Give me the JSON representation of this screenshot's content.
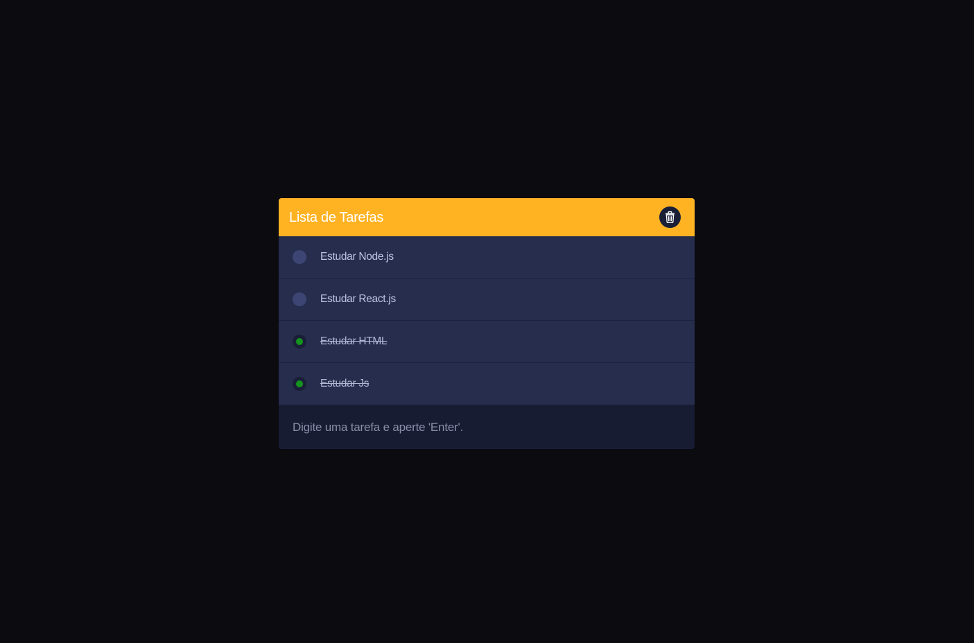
{
  "header": {
    "title": "Lista de Tarefas",
    "clear_icon": "trash-icon"
  },
  "tasks": [
    {
      "label": "Estudar Node.js",
      "done": false
    },
    {
      "label": "Estudar React.js",
      "done": false
    },
    {
      "label": "Estudar HTML",
      "done": true
    },
    {
      "label": "Estudar Js",
      "done": true
    }
  ],
  "input": {
    "value": "",
    "placeholder": "Digite uma tarefa e aperte 'Enter'."
  },
  "colors": {
    "page_background": "#0b0b10",
    "header_accent": "#ffb323",
    "item_background": "#262d4d",
    "input_background": "#181c33",
    "done_indicator": "#14931e"
  }
}
